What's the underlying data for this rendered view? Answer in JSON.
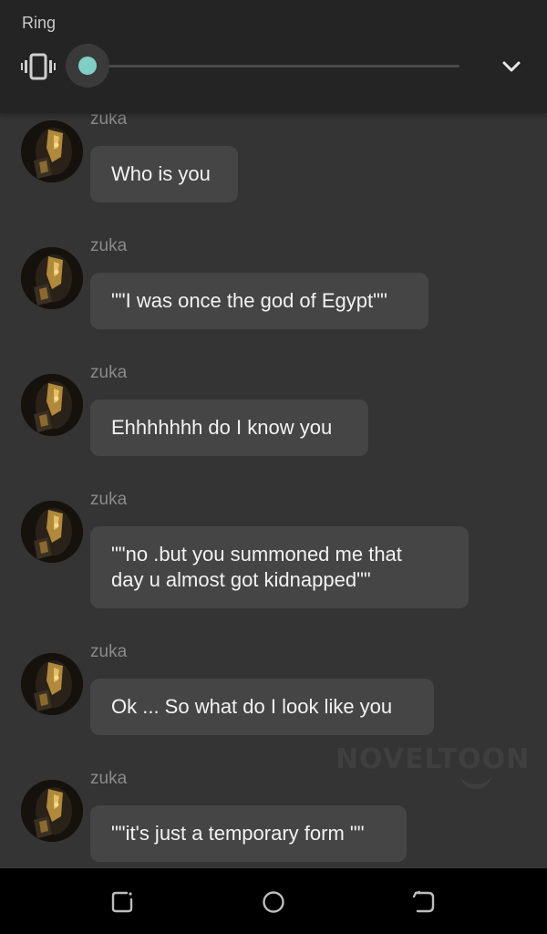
{
  "volume": {
    "label": "Ring",
    "level": 0,
    "accent_color": "#7fcfc4",
    "mode_icon": "vibrate-icon",
    "collapse_icon": "chevron-down-icon"
  },
  "messages": [
    {
      "sender": "zuka",
      "text": "Who is you"
    },
    {
      "sender": "zuka",
      "text": "\"\"I was once the god of Egypt\"\""
    },
    {
      "sender": "zuka",
      "text": "Ehhhhhhh do I know you"
    },
    {
      "sender": "zuka",
      "text": "\"\"no .but you summoned me that\nday u almost got kidnapped\"\""
    },
    {
      "sender": "zuka",
      "text": "Ok ... So what do I look like you"
    },
    {
      "sender": "zuka",
      "text": "\"\"it's just a temporary form \"\""
    }
  ],
  "watermark": "NOVELTOON",
  "navbar": {
    "recents_icon": "recents-icon",
    "home_icon": "home-icon",
    "back_icon": "back-icon"
  }
}
